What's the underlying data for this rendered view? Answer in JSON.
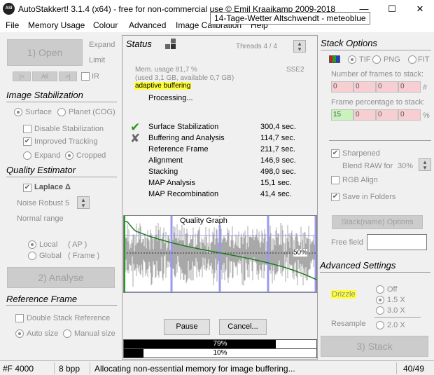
{
  "window": {
    "title": "AutoStakkert! 3.1.4 (x64) - free for non-commercial use © Emil Kraaikamp 2009-2018",
    "tooltip": "14-Tage-Wetter Altschwendt - meteoblue",
    "app_icon_text": "ASI",
    "minimize": "—",
    "maximize": "☐",
    "close": "✕"
  },
  "menu": [
    "File",
    "Memory Usage",
    "Colour",
    "Advanced",
    "Image Calibration",
    "Help"
  ],
  "left": {
    "open_button": "1) Open",
    "expand": "Expand",
    "limit": "Limit",
    "nav_prev": "|<",
    "nav_all": "All",
    "nav_next": ">|",
    "ir": "IR",
    "image_stab_title": "Image Stabilization",
    "surface": "Surface",
    "planet": "Planet (COG)",
    "disable_stab": "Disable Stabilization",
    "improved_tracking": "Improved Tracking",
    "expand_radio": "Expand",
    "cropped": "Cropped",
    "quality_title": "Quality Estimator",
    "laplace": "Laplace Δ",
    "noise_robust": "Noise Robust",
    "noise_value": "5",
    "normal_range": "Normal range",
    "local": "Local",
    "local_ap": "( AP )",
    "global": "Global",
    "global_frame": "( Frame )",
    "analyse_button": "2) Analyse",
    "reference_title": "Reference Frame",
    "double_stack": "Double Stack Reference",
    "auto_size": "Auto size",
    "manual_size": "Manual size"
  },
  "status": {
    "title": "Status",
    "threads": "Threads 4 / 4",
    "mem_usage": "Mem. usage 81,7 %",
    "mem_detail": "(used 3,1 GB, available 0,7 GB)",
    "sse": "SSE2",
    "adaptive": "adaptive buffering",
    "processing": "Processing...",
    "tasks": [
      {
        "name": "Surface Stabilization",
        "time": "300,4 sec.",
        "mark": "✔"
      },
      {
        "name": "Buffering and Analysis",
        "time": "114,7 sec.",
        "mark": "✘"
      },
      {
        "name": "Reference Frame",
        "time": "211,7 sec.",
        "mark": ""
      },
      {
        "name": "Alignment",
        "time": "146,9 sec.",
        "mark": ""
      },
      {
        "name": "Stacking",
        "time": "498,0 sec.",
        "mark": ""
      },
      {
        "name": "MAP Analysis",
        "time": "15,1 sec.",
        "mark": ""
      },
      {
        "name": "MAP Recombination",
        "time": "41,4 sec.",
        "mark": ""
      }
    ],
    "graph_label": "Quality Graph",
    "graph_pct": "50%",
    "pause": "Pause",
    "cancel": "Cancel...",
    "progress1_label": "79%",
    "progress1_value": 0.79,
    "progress2_label": "10%",
    "progress2_value": 0.1
  },
  "right": {
    "stack_options_title": "Stack Options",
    "tif": "TIF",
    "png": "PNG",
    "fit": "FIT",
    "frames_label": "Number of frames to stack:",
    "frames_cells": [
      "0",
      "0",
      "0",
      "0"
    ],
    "frames_unit": "#",
    "pct_label": "Frame percentage to stack:",
    "pct_cells": [
      "15",
      "0",
      "0",
      "0"
    ],
    "pct_unit": "%",
    "sharpened": "Sharpened",
    "blend_raw": "Blend RAW for",
    "blend_value": "30%",
    "rgb_align": "RGB Align",
    "save_folders": "Save in Folders",
    "stack_name_button": "Stack(name) Options",
    "free_field": "Free field",
    "free_field_value": "",
    "advanced_title": "Advanced Settings",
    "drizzle": "Drizzle",
    "off": "Off",
    "x15": "1.5 X",
    "x30": "3.0 X",
    "resample": "Resample",
    "x20": "2.0 X",
    "stack_button": "3) Stack"
  },
  "statusbar": {
    "frames": "#F 4000",
    "bpp": "8 bpp",
    "message": "Allocating non-essential memory for image buffering...",
    "counter": "40/49"
  }
}
